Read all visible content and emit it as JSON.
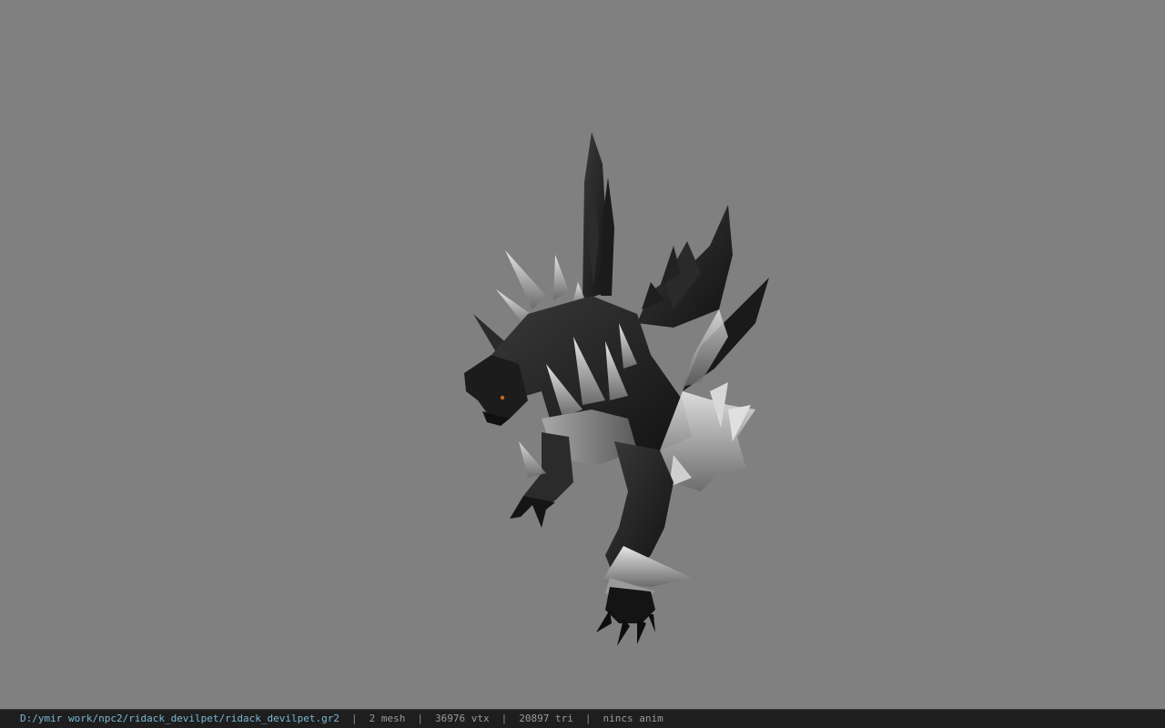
{
  "viewport": {
    "background_color": "#808080",
    "model_name": "devil pet creature model"
  },
  "statusbar": {
    "file_path": "D:/ymir work/npc2/ridack_devilpet/ridack_devilpet.gr2",
    "separator": "|",
    "mesh_count": "2 mesh",
    "vertex_count": "36976 vtx",
    "triangle_count": "20897 tri",
    "anim_status": "nincs anim",
    "path_color": "#79b8d6",
    "text_color": "#9a9a9a"
  }
}
